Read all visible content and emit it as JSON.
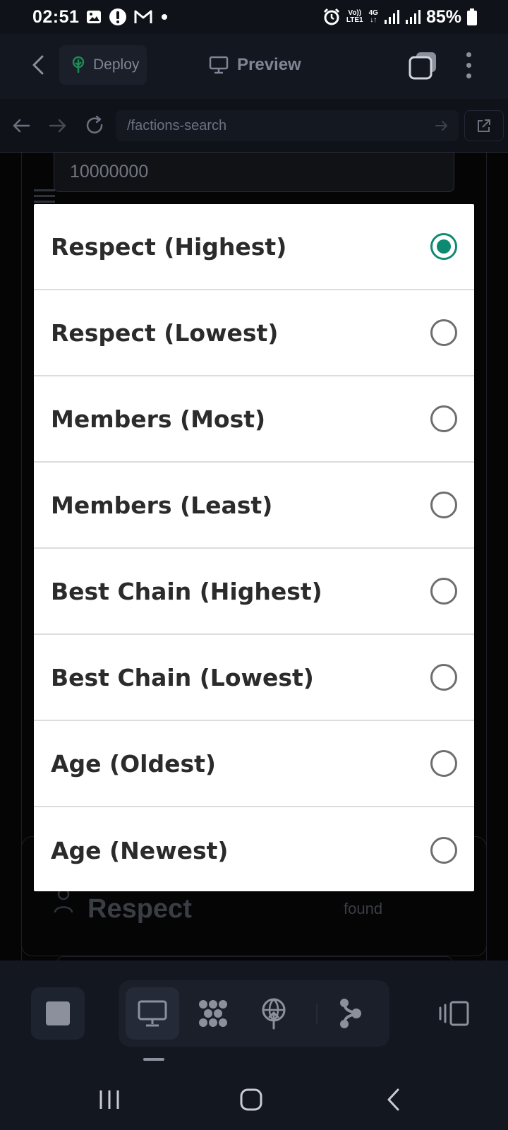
{
  "status_bar": {
    "time": "02:51",
    "network_label_top": "Vo))",
    "network_label_bottom": "LTE1",
    "network_type": "4G",
    "battery": "85%"
  },
  "top_bar": {
    "deploy_label": "Deploy",
    "preview_label": "Preview"
  },
  "browser": {
    "url": "/factions-search"
  },
  "page": {
    "amount_value": "10000000",
    "results_title": "Respect",
    "results_found": "found"
  },
  "sort_dialog": {
    "options": [
      {
        "label": "Respect (Highest)",
        "selected": true
      },
      {
        "label": "Respect (Lowest)",
        "selected": false
      },
      {
        "label": "Members (Most)",
        "selected": false
      },
      {
        "label": "Members (Least)",
        "selected": false
      },
      {
        "label": "Best Chain (Highest)",
        "selected": false
      },
      {
        "label": "Best Chain (Lowest)",
        "selected": false
      },
      {
        "label": "Age (Oldest)",
        "selected": false
      },
      {
        "label": "Age (Newest)",
        "selected": false
      }
    ]
  },
  "colors": {
    "accent": "#0d8a72",
    "background": "#0c0d10",
    "toolbar": "#131720"
  }
}
